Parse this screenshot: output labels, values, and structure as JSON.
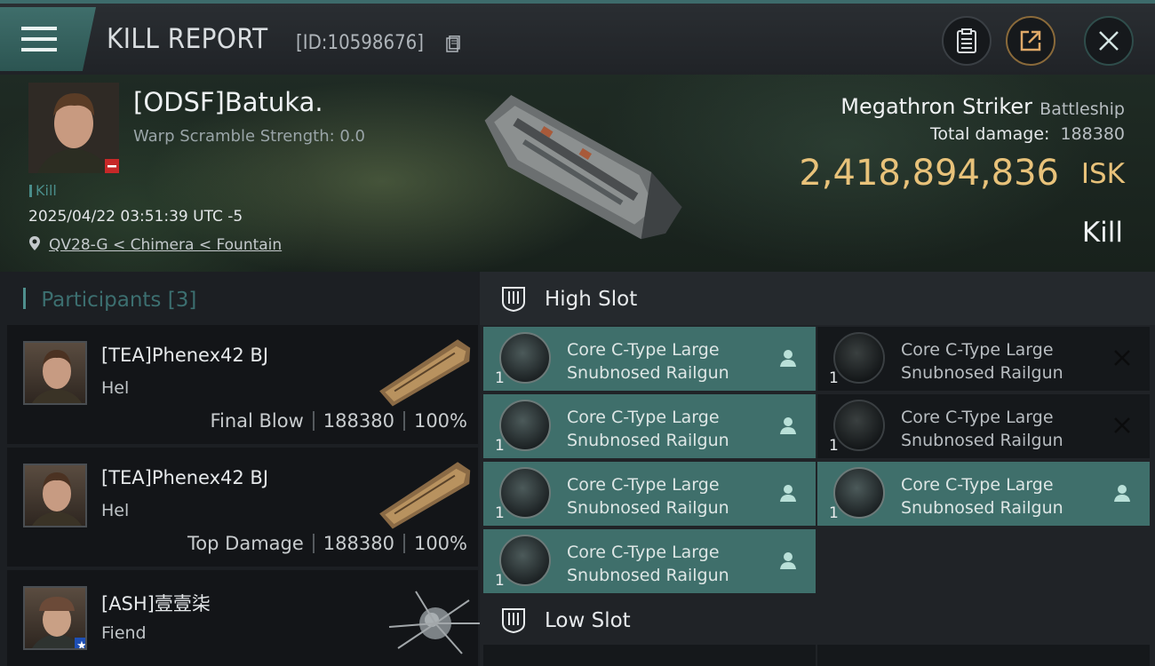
{
  "header": {
    "title": "KILL REPORT",
    "report_id": "[ID:10598676]",
    "icons": [
      "menu-icon",
      "copy-icon",
      "clipboard-icon",
      "share-icon",
      "close-icon"
    ]
  },
  "victim": {
    "name": "[ODSF]Batuka.",
    "warp_scramble": "Warp Scramble Strength: 0.0",
    "kill_tag": "Kill",
    "timestamp": "2025/04/22 03:51:39 UTC -5",
    "location": "QV28-G < Chimera < Fountain",
    "ship_name": "Megathron Striker",
    "ship_class": "Battleship",
    "total_damage_label": "Total damage:",
    "total_damage": "188380",
    "isk_value": "2,418,894,836",
    "isk_unit": "ISK",
    "result": "Kill"
  },
  "participants": {
    "label": "Participants",
    "count": "[3]",
    "rows": [
      {
        "name": "[TEA]Phenex42 BJ",
        "ship": "Hel",
        "tag": "Final Blow",
        "damage": "188380",
        "percent": "100%"
      },
      {
        "name": "[TEA]Phenex42 BJ",
        "ship": "Hel",
        "tag": "Top Damage",
        "damage": "188380",
        "percent": "100%"
      },
      {
        "name": "[ASH]壹壹柒",
        "ship": "Fiend",
        "tag": "",
        "damage": "",
        "percent": ""
      }
    ]
  },
  "slots": {
    "high_label": "High Slot",
    "low_label": "Low Slot",
    "high_modules": [
      {
        "name_line1": "Core C-Type Large",
        "name_line2": "Snubnosed Railgun",
        "qty": "1",
        "state": "fitted"
      },
      {
        "name_line1": "Core C-Type Large",
        "name_line2": "Snubnosed Railgun",
        "qty": "1",
        "state": "destroyed"
      },
      {
        "name_line1": "Core C-Type Large",
        "name_line2": "Snubnosed Railgun",
        "qty": "1",
        "state": "fitted"
      },
      {
        "name_line1": "Core C-Type Large",
        "name_line2": "Snubnosed Railgun",
        "qty": "1",
        "state": "destroyed"
      },
      {
        "name_line1": "Core C-Type Large",
        "name_line2": "Snubnosed Railgun",
        "qty": "1",
        "state": "fitted"
      },
      {
        "name_line1": "Core C-Type Large",
        "name_line2": "Snubnosed Railgun",
        "qty": "1",
        "state": "fitted"
      },
      {
        "name_line1": "Core C-Type Large",
        "name_line2": "Snubnosed Railgun",
        "qty": "1",
        "state": "fitted"
      }
    ]
  },
  "colors": {
    "accent_teal": "#3f6f6b",
    "isk_gold": "#e8c27a",
    "participants_header": "#3c6f70"
  }
}
